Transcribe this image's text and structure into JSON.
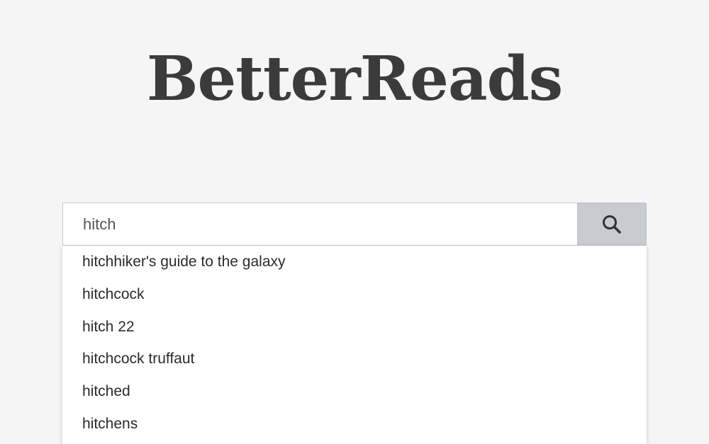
{
  "app": {
    "logo_text": "BetterReads"
  },
  "search": {
    "value": "hitch",
    "button_icon": "search-icon"
  },
  "suggestions": [
    "hitchhiker's guide to the galaxy",
    "hitchcock",
    "hitch 22",
    "hitchcock truffaut",
    "hitched",
    "hitchens"
  ],
  "colors": {
    "background": "#f5f5f5",
    "logo": "#3b3b3b",
    "button": "#c8cbcf"
  }
}
